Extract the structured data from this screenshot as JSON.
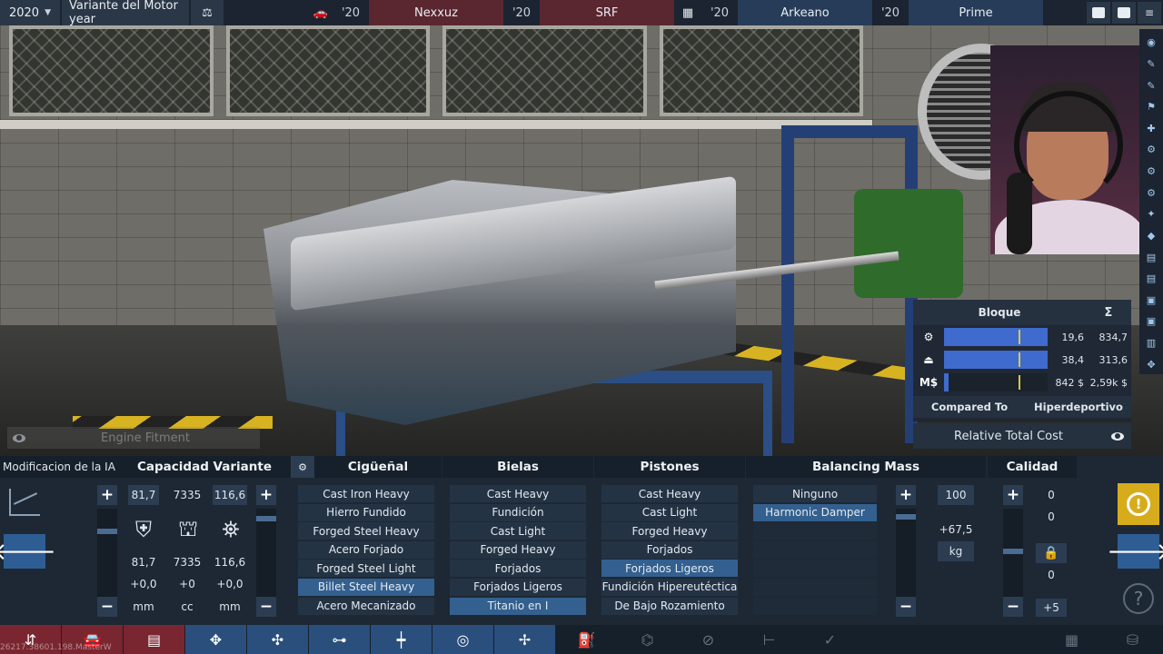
{
  "topbar": {
    "year": "2020",
    "title": "Variante del Motor year",
    "slots": [
      {
        "year": "'20",
        "name": "Nexxuz",
        "color": "#5a2630"
      },
      {
        "year": "'20",
        "name": "SRF",
        "color": "#5a2630"
      },
      {
        "year": "'20",
        "name": "Arkeano",
        "color": "#263c58"
      },
      {
        "year": "'20",
        "name": "Prime",
        "color": "#263c58"
      }
    ]
  },
  "stats": {
    "header": "Bloque",
    "sum_symbol": "Σ",
    "rows": [
      {
        "icon": "engine-icon",
        "value": "19,6",
        "total": "834,7",
        "fill": 1.0
      },
      {
        "icon": "weight-icon",
        "value": "38,4",
        "total": "313,6",
        "fill": 1.0
      },
      {
        "icon_text": "M$",
        "value": "842 $",
        "total": "2,59k $",
        "fill": 0.04
      }
    ],
    "compared_to_label": "Compared To",
    "compared_to_value": "Hiperdeportivo",
    "relative_total_cost": "Relative Total Cost"
  },
  "fitment_label": "Engine Fitment",
  "ai_label": "Modificacion de la IA",
  "capacity": {
    "title": "Capacidad Variante",
    "bore": "81,7",
    "displacement": "7335",
    "stroke": "116,6",
    "bore2": "81,7",
    "displacement2": "7335",
    "stroke2": "116,6",
    "bore_delta": "+0,0",
    "disp_delta": "+0",
    "stroke_delta": "+0,0",
    "unit_mm": "mm",
    "unit_cc": "cc",
    "unit_mm2": "mm"
  },
  "crankshaft": {
    "title": "Cigüeñal",
    "items": [
      "Cast Iron Heavy",
      "Hierro Fundido",
      "Forged Steel Heavy",
      "Acero Forjado",
      "Forged Steel Light",
      "Billet Steel Heavy",
      "Acero Mecanizado"
    ],
    "selected": 5
  },
  "conrods": {
    "title": "Bielas",
    "items": [
      "Cast Heavy",
      "Fundición",
      "Cast Light",
      "Forged Heavy",
      "Forjados",
      "Forjados Ligeros",
      "Titanio en I"
    ],
    "selected": 6
  },
  "pistons": {
    "title": "Pistones",
    "items": [
      "Cast Heavy",
      "Cast Light",
      "Forged Heavy",
      "Forjados",
      "Forjados Ligeros",
      "Fundición Hipereutéctica",
      "De Bajo Rozamiento"
    ],
    "selected": 4
  },
  "balancing": {
    "title": "Balancing Mass",
    "items": [
      "Ninguno",
      "Harmonic Damper",
      "",
      "",
      "",
      "",
      ""
    ],
    "selected": 1,
    "value": "100",
    "delta": "+67,5",
    "unit": "kg"
  },
  "quality": {
    "title": "Calidad",
    "v1": "0",
    "v2": "0",
    "v3": "0",
    "delta": "+5"
  },
  "watermark": "26217.38601.198.MasterW",
  "colors": {
    "accent": "#33608f",
    "warning": "#d6ac1d",
    "team_red": "#7a2630",
    "team_blue": "#2a4f7d"
  }
}
